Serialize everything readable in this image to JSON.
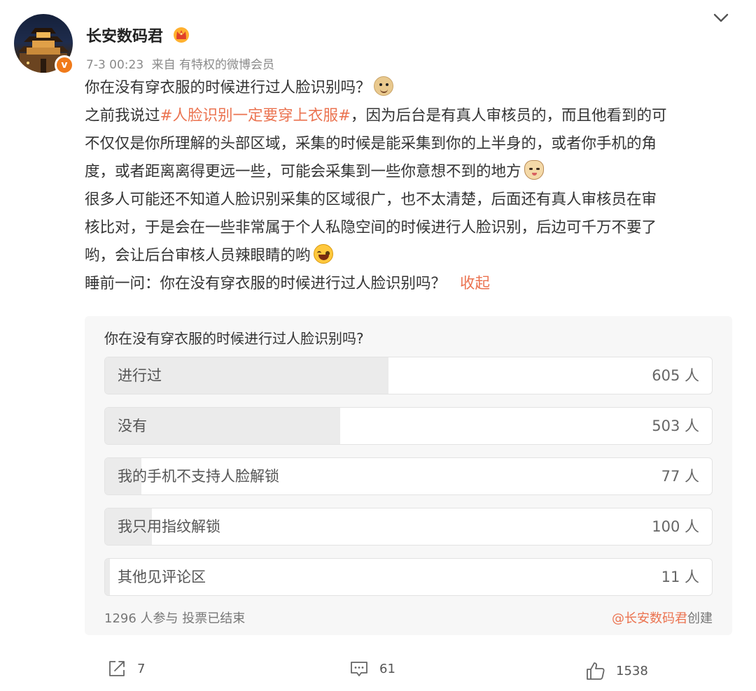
{
  "header": {
    "username": "长安数码君",
    "timestamp": "7-3 00:23",
    "source_prefix": "来自",
    "source": "有特权的微博会员",
    "verified_badge": "v",
    "icons": {
      "member": "crown-icon",
      "menu": "chevron-down-icon"
    }
  },
  "post": {
    "line1": "你在没有穿衣服的时候进行过人脸识别吗？",
    "line2_before": "之前我说过",
    "hashtag": "#人脸识别一定要穿上衣服#",
    "line2_after": "，因为后台是有真人审核员的，而且他看到的可",
    "line3": "不仅仅是你所理解的头部区域，采集的时候是能采集到你的上半身的，或者你手机的角",
    "line4": "度，或者距离离得更远一些，可能会采集到一些你意想不到的地方",
    "line5": "很多人可能还不知道人脸识别采集的区域很广，也不太清楚，后面还有真人审核员在审",
    "line6": "核比对，于是会在一些非常属于个人私隐空间的时候进行人脸识别，后边可千万不要了",
    "line7": "哟，会让后台审核人员辣眼睛的哟",
    "line8": "睡前一问：你在没有穿衣服的时候进行过人脸识别吗？",
    "collapse_label": "收起",
    "emojis": [
      "doge-emoji",
      "cat-emoji",
      "laugh-cry-emoji"
    ]
  },
  "poll": {
    "question": "你在没有穿衣服的时候进行过人脸识别吗?",
    "options": [
      {
        "label": "进行过",
        "count": "605 人",
        "votes": 605
      },
      {
        "label": "没有",
        "count": "503 人",
        "votes": 503
      },
      {
        "label": "我的手机不支持人脸解锁",
        "count": "77 人",
        "votes": 77
      },
      {
        "label": "我只用指纹解锁",
        "count": "100 人",
        "votes": 100
      },
      {
        "label": "其他见评论区",
        "count": "11 人",
        "votes": 11
      }
    ],
    "total_votes": 1296,
    "status": "1296 人参与 投票已结束",
    "creator_mention": "@长安数码君",
    "creator_suffix": "创建"
  },
  "actions": {
    "repost": {
      "count": "7",
      "icon": "repost-icon"
    },
    "comment": {
      "count": "61",
      "icon": "comment-icon"
    },
    "like": {
      "count": "1538",
      "icon": "like-icon"
    }
  },
  "colors": {
    "accent": "#eb7350",
    "text": "#333333",
    "meta": "#8a8a8a",
    "poll_bg": "#f7f7f7",
    "poll_fill": "#ebebeb"
  }
}
